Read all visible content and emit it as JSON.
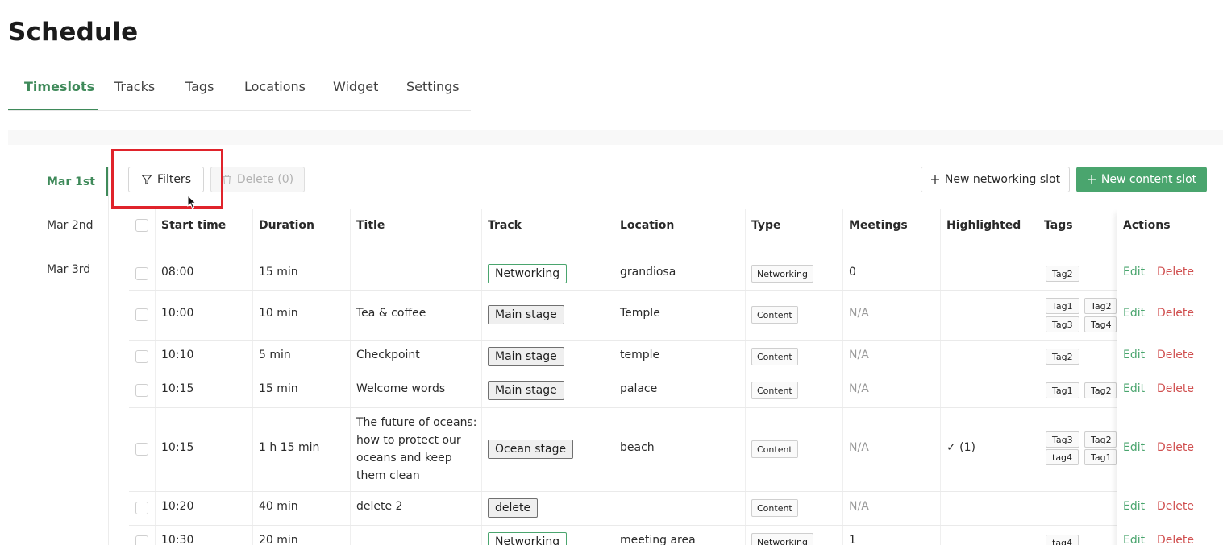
{
  "page_title": "Schedule",
  "tabs": [
    {
      "label": "Timeslots"
    },
    {
      "label": "Tracks"
    },
    {
      "label": "Tags"
    },
    {
      "label": "Locations"
    },
    {
      "label": "Widget"
    },
    {
      "label": "Settings"
    }
  ],
  "days": [
    {
      "label": "Mar 1st"
    },
    {
      "label": "Mar 2nd"
    },
    {
      "label": "Mar 3rd"
    }
  ],
  "toolbar": {
    "filters_label": "Filters",
    "delete_label": "Delete (0)",
    "new_networking_label": "New networking slot",
    "new_content_label": "New content slot"
  },
  "columns": {
    "start": "Start time",
    "duration": "Duration",
    "title": "Title",
    "track": "Track",
    "location": "Location",
    "type": "Type",
    "meetings": "Meetings",
    "highlighted": "Highlighted",
    "tags": "Tags",
    "actions": "Actions"
  },
  "actions": {
    "edit": "Edit",
    "delete": "Delete"
  },
  "rows": [
    {
      "start": "08:00",
      "duration": "15 min",
      "title": "",
      "track": "Networking",
      "location": "grandiosa",
      "type": "Networking",
      "meetings": "0",
      "highlighted": "",
      "tags": [
        "Tag2"
      ]
    },
    {
      "start": "10:00",
      "duration": "10 min",
      "title": "Tea & coffee",
      "track": "Main stage",
      "location": "Temple",
      "type": "Content",
      "meetings": "N/A",
      "highlighted": "",
      "tags": [
        "Tag1",
        "Tag2",
        "Tag3",
        "Tag4"
      ]
    },
    {
      "start": "10:10",
      "duration": "5 min",
      "title": "Checkpoint",
      "track": "Main stage",
      "location": "temple",
      "type": "Content",
      "meetings": "N/A",
      "highlighted": "",
      "tags": [
        "Tag2"
      ]
    },
    {
      "start": "10:15",
      "duration": "15 min",
      "title": "Welcome words",
      "track": "Main stage",
      "location": "palace",
      "type": "Content",
      "meetings": "N/A",
      "highlighted": "",
      "tags": [
        "Tag1",
        "Tag2"
      ]
    },
    {
      "start": "10:15",
      "duration": "1 h 15 min",
      "title": "The future of oceans: how to protect our oceans and keep them clean",
      "track": "Ocean stage",
      "location": "beach",
      "type": "Content",
      "meetings": "N/A",
      "highlighted": "✓ (1)",
      "tags": [
        "Tag3",
        "Tag2",
        "tag4",
        "Tag1"
      ]
    },
    {
      "start": "10:20",
      "duration": "40 min",
      "title": "delete 2",
      "track": "delete",
      "location": "",
      "type": "Content",
      "meetings": "N/A",
      "highlighted": "",
      "tags": []
    },
    {
      "start": "10:30",
      "duration": "20 min",
      "title": "",
      "track": "Networking",
      "location": "meeting area",
      "type": "Networking",
      "meetings": "1",
      "highlighted": "",
      "tags": [
        "tag4"
      ]
    }
  ],
  "colors": {
    "accent": "#3f8a5a",
    "primary_button": "#4aa56e",
    "delete_link": "#d05050",
    "annotation_box": "#e0232b"
  }
}
